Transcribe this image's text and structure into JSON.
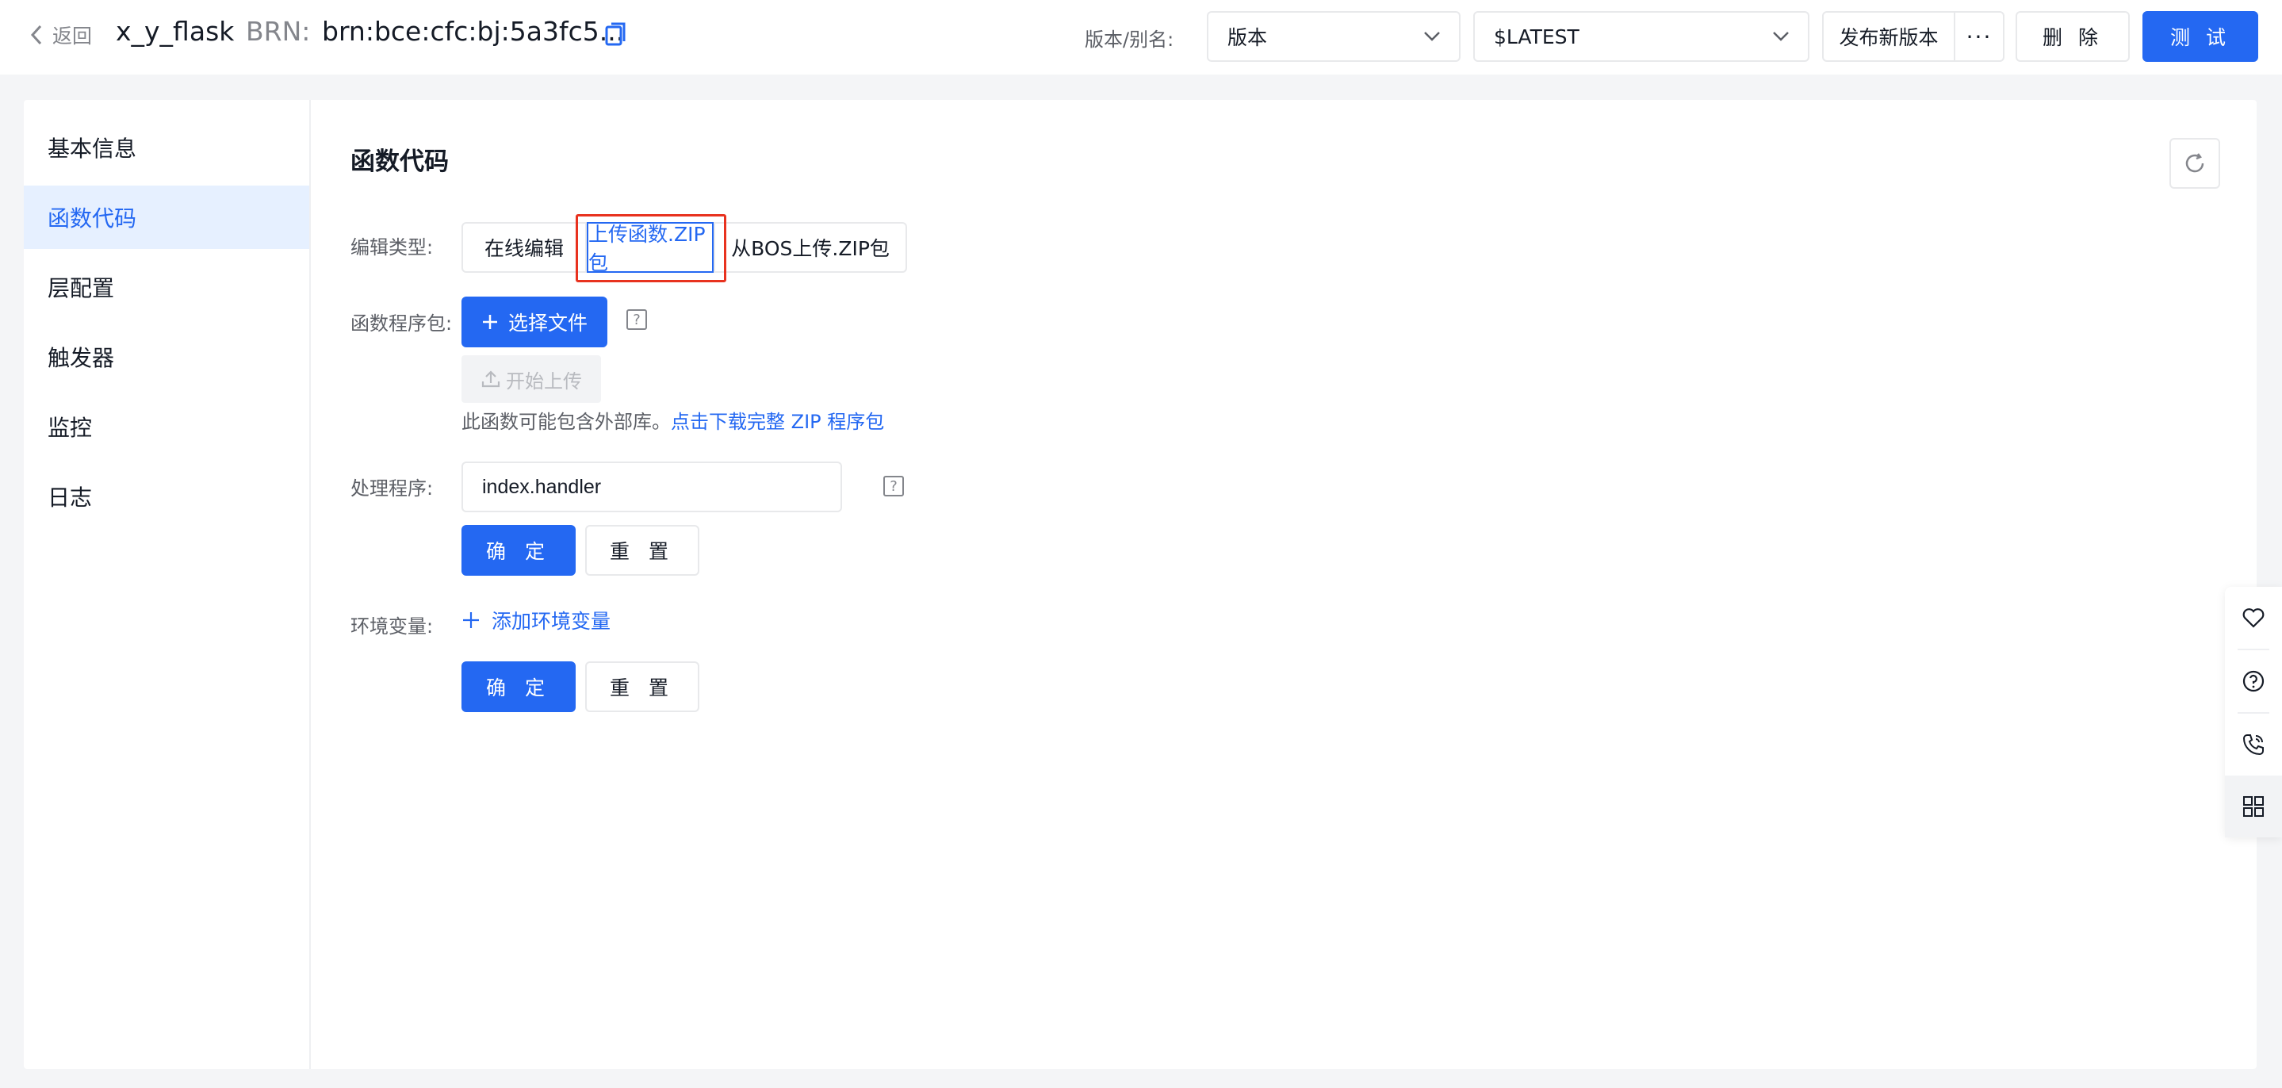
{
  "topbar": {
    "back_label": "返回",
    "function_name": "x_y_flask",
    "brn_label": "BRN:",
    "brn_value": "brn:bce:cfc:bj:5a3fc5...",
    "version_label": "版本/别名:",
    "version_type": "版本",
    "version_value": "$LATEST",
    "publish_label": "发布新版本",
    "more_label": "···",
    "delete_label": "删 除",
    "test_label": "测 试"
  },
  "sidebar": {
    "items": [
      {
        "label": "基本信息"
      },
      {
        "label": "函数代码"
      },
      {
        "label": "层配置"
      },
      {
        "label": "触发器"
      },
      {
        "label": "监控"
      },
      {
        "label": "日志"
      }
    ]
  },
  "main": {
    "title": "函数代码",
    "edit_type_label": "编辑类型:",
    "edit_types": [
      "在线编辑",
      "上传函数.ZIP包",
      "从BOS上传.ZIP包"
    ],
    "package_label": "函数程序包:",
    "choose_file_label": "选择文件",
    "start_upload_label": "开始上传",
    "hint_text": "此函数可能包含外部库。",
    "hint_link": "点击下载完整 ZIP 程序包",
    "handler_label": "处理程序:",
    "handler_value": "index.handler",
    "confirm_label": "确 定",
    "reset_label": "重 置",
    "env_label": "环境变量:",
    "add_env_label": "添加环境变量"
  },
  "colors": {
    "primary": "#2468f2",
    "highlight_box": "#e8321f",
    "active_nav_bg": "#e6f0ff"
  }
}
